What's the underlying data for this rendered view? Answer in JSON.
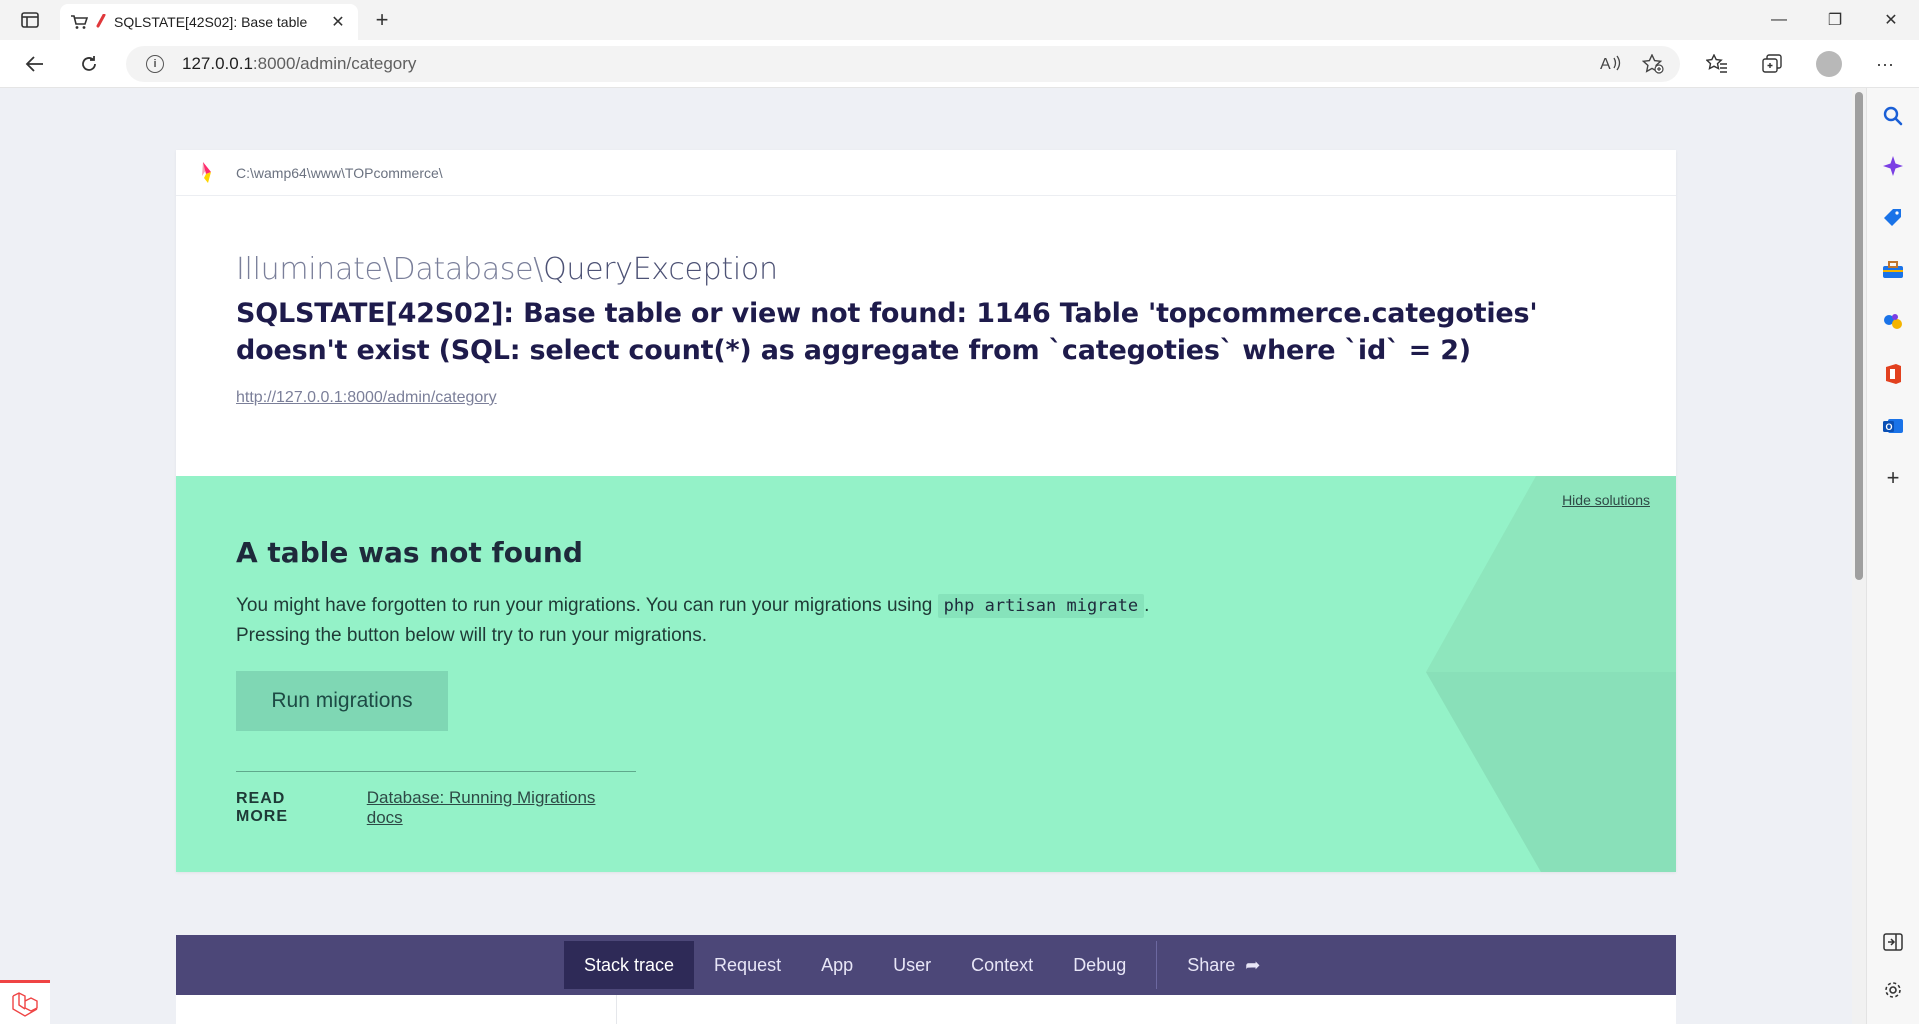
{
  "browser": {
    "tab_title": "SQLSTATE[42S02]: Base table",
    "tab_close": "✕",
    "new_tab": "+",
    "url_host": "127.0.0.1",
    "url_path": ":8000/admin/category",
    "win_minimize": "—",
    "win_restore": "❐",
    "win_close": "✕"
  },
  "header": {
    "path": "C:\\wamp64\\www\\TOPcommerce\\"
  },
  "exception": {
    "namespace": "Illuminate\\Database\\",
    "class": "QueryException",
    "message": "SQLSTATE[42S02]: Base table or view not found: 1146 Table 'topcommerce.categoties' doesn't exist (SQL: select count(*) as aggregate from `categoties` where `id` = 2)",
    "url": "http://127.0.0.1:8000/admin/category"
  },
  "solution": {
    "hide_label": "Hide solutions",
    "title": "A table was not found",
    "desc_part1": "You might have forgotten to run your migrations. You can run your migrations using ",
    "desc_code": "php artisan migrate",
    "desc_part2": ".",
    "desc_line2": "Pressing the button below will try to run your migrations.",
    "button_label": "Run migrations",
    "read_more_label": "READ MORE",
    "read_more_link": "Database: Running Migrations docs"
  },
  "tabs": {
    "stack_trace": "Stack trace",
    "request": "Request",
    "app": "App",
    "user": "User",
    "context": "Context",
    "debug": "Debug",
    "share": "Share",
    "share_icon": "➦"
  },
  "colors": {
    "solution_bg": "#94f2c8",
    "nav_bg": "#4c4778",
    "nav_active": "#2e2a57",
    "message": "#1e1b4b"
  }
}
